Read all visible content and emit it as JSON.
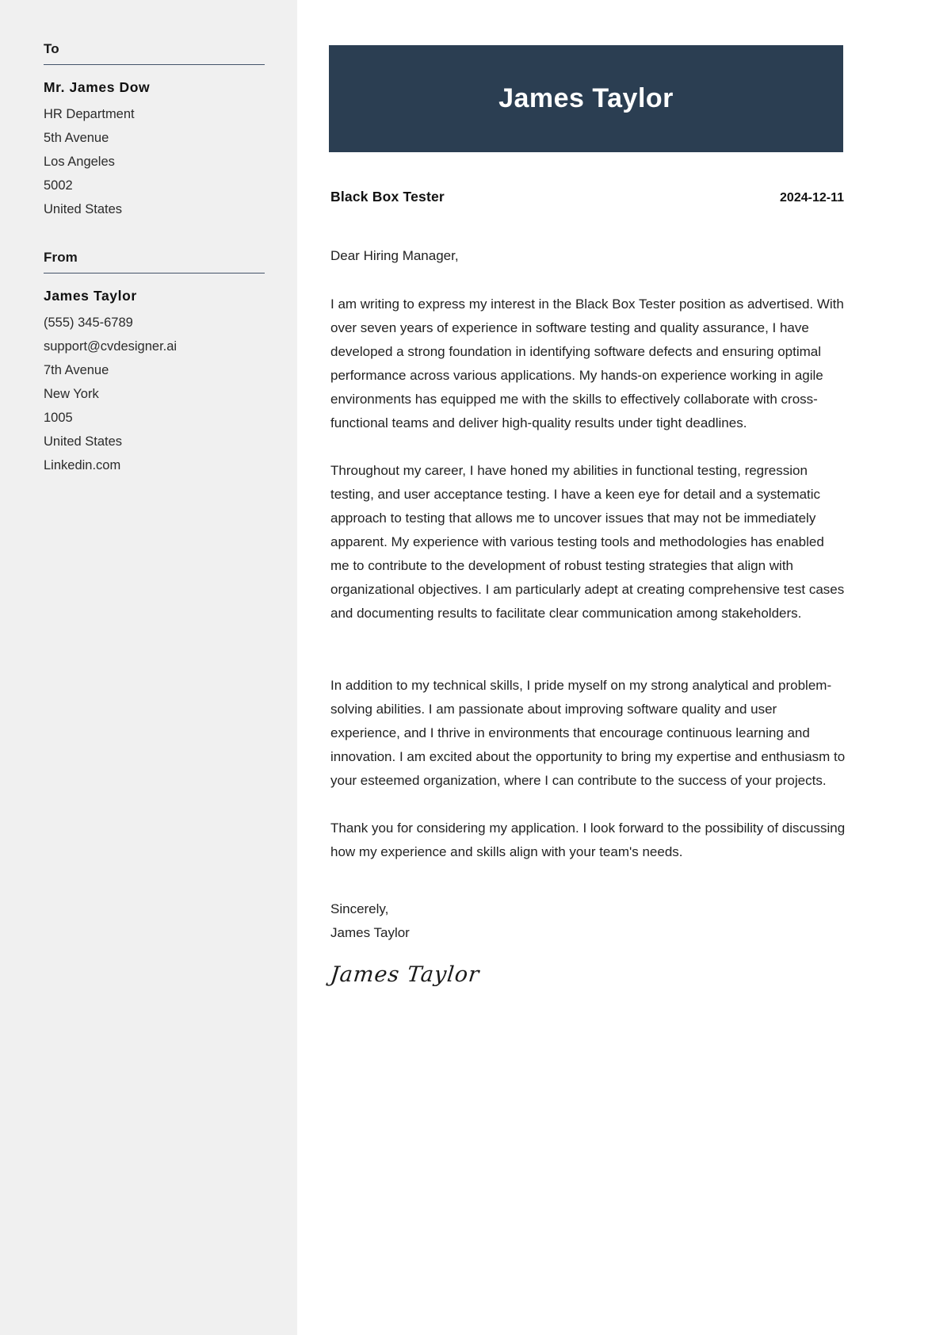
{
  "sidebar": {
    "to": {
      "heading": "To",
      "name": "Mr. James Dow",
      "lines": [
        "HR Department",
        "5th Avenue",
        "Los Angeles",
        "5002",
        "United States"
      ]
    },
    "from": {
      "heading": "From",
      "name": "James Taylor",
      "lines": [
        "(555) 345-6789",
        "support@cvdesigner.ai",
        "7th Avenue",
        "New York",
        "1005",
        "United States",
        "Linkedin.com"
      ]
    }
  },
  "letter": {
    "banner_name": "James Taylor",
    "job_title": "Black Box Tester",
    "date": "2024-12-11",
    "salutation": "Dear Hiring Manager,",
    "paragraphs": [
      "I am writing to express my interest in the Black Box Tester position as advertised. With over seven years of experience in software testing and quality assurance, I have developed a strong foundation in identifying software defects and ensuring optimal performance across various applications. My hands-on experience working in agile environments has equipped me with the skills to effectively collaborate with cross-functional teams and deliver high-quality results under tight deadlines.",
      "Throughout my career, I have honed my abilities in functional testing, regression testing, and user acceptance testing. I have a keen eye for detail and a systematic approach to testing that allows me to uncover issues that may not be immediately apparent. My experience with various testing tools and methodologies has enabled me to contribute to the development of robust testing strategies that align with organizational objectives. I am particularly adept at creating comprehensive test cases and documenting results to facilitate clear communication among stakeholders.",
      "In addition to my technical skills, I pride myself on my strong analytical and problem-solving abilities. I am passionate about improving software quality and user experience, and I thrive in environments that encourage continuous learning and innovation. I am excited about the opportunity to bring my expertise and enthusiasm to your esteemed organization, where I can contribute to the success of your projects.",
      "Thank you for considering my application. I look forward to the possibility of discussing how my experience and skills align with your team's needs."
    ],
    "closing_word": "Sincerely,",
    "closing_name": "James Taylor",
    "signature_script": "James Taylor"
  },
  "colors": {
    "banner": "#2b3e52",
    "sidebar_bg": "#f0f0f0",
    "rule": "#44546a"
  }
}
